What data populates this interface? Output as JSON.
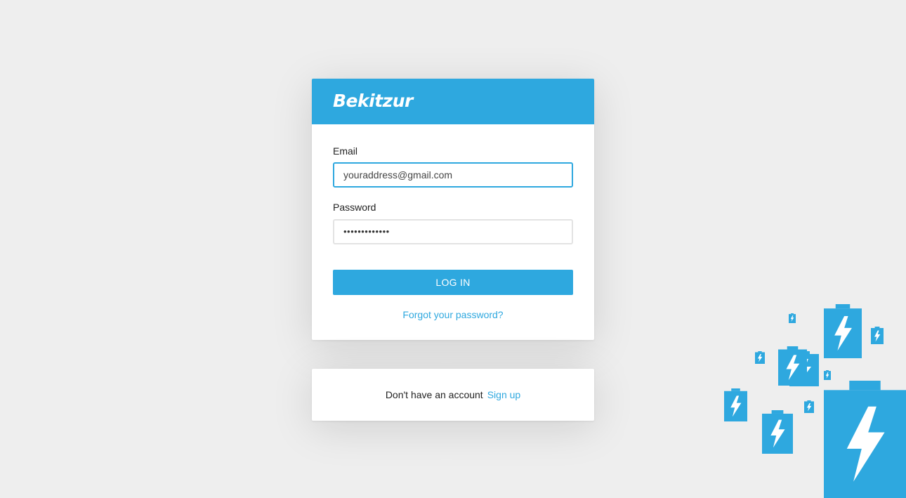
{
  "brand": {
    "name": "Bekitzur"
  },
  "login_form": {
    "email_label": "Email",
    "email_value": "youraddress@gmail.com",
    "password_label": "Password",
    "password_value": "•••••••••••••",
    "login_button": "LOG IN",
    "forgot_link": "Forgot your password?"
  },
  "signup": {
    "prompt": "Don't have an account",
    "link": "Sign up"
  },
  "decoration": {
    "icon": "battery-charging-icon",
    "color": "#2ea8df"
  },
  "colors": {
    "accent": "#2ea8df",
    "background": "#eeeeee"
  }
}
